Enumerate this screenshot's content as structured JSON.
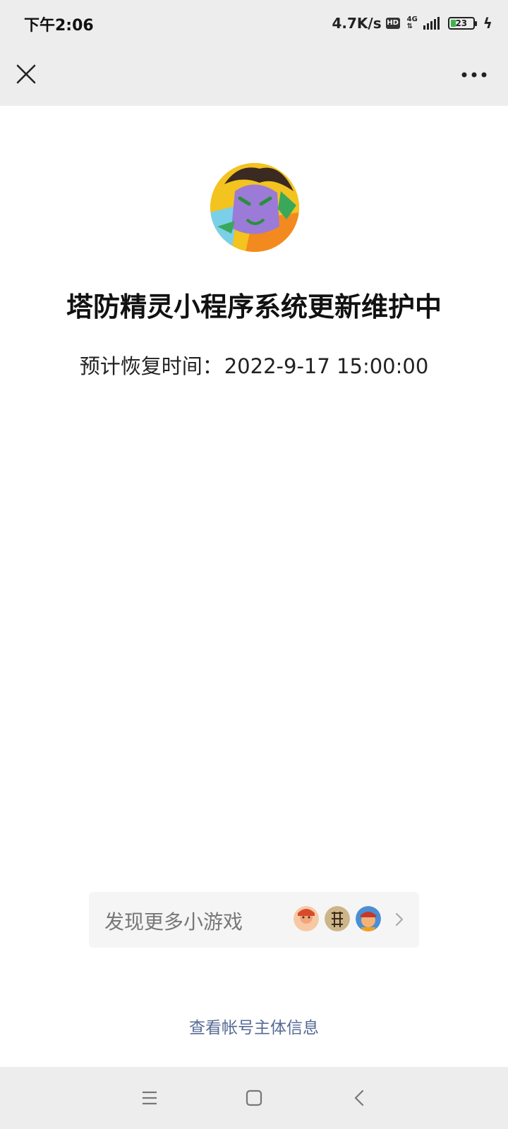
{
  "status_bar": {
    "time": "下午2:06",
    "net_speed": "4.7K/s",
    "hd_badge": "HD",
    "network_type": "4G",
    "battery_level": "23",
    "battery_fraction": 0.23
  },
  "header": {
    "close_icon": "close-icon",
    "more_icon": "more-icon"
  },
  "main": {
    "title": "塔防精灵小程序系统更新维护中",
    "eta_label": "预计恢复时间：",
    "eta_value": "2022-9-17 15:00:00"
  },
  "discover": {
    "label": "发现更多小游戏",
    "game_icons": [
      "game-icon-1",
      "game-icon-2",
      "game-icon-3"
    ],
    "chevron_icon": "chevron-right-icon"
  },
  "footer": {
    "account_link": "查看帐号主体信息"
  },
  "nav_bar": {
    "menu_icon": "menu-icon",
    "home_icon": "home-icon",
    "back_icon": "back-icon"
  },
  "colors": {
    "header_bg": "#ededed",
    "link": "#576b95",
    "battery_green": "#3bb54a"
  }
}
